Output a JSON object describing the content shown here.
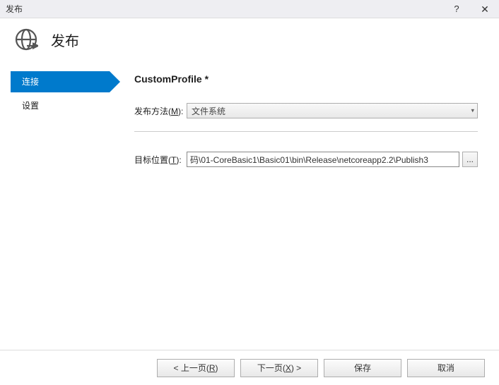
{
  "titlebar": {
    "title": "发布",
    "help": "?",
    "close": "✕"
  },
  "header": {
    "title": "发布"
  },
  "sidebar": {
    "items": [
      {
        "label": "连接",
        "active": true
      },
      {
        "label": "设置",
        "active": false
      }
    ]
  },
  "main": {
    "profile_title": "CustomProfile *",
    "publish_method": {
      "label_pre": "发布方法(",
      "label_key": "M",
      "label_post": "):",
      "value": "文件系统"
    },
    "target_location": {
      "label_pre": "目标位置(",
      "label_key": "T",
      "label_post": "):",
      "value": "码\\01-CoreBasic1\\Basic01\\bin\\Release\\netcoreapp2.2\\Publish3",
      "browse": "..."
    }
  },
  "footer": {
    "prev_pre": "< 上一页(",
    "prev_key": "R",
    "prev_post": ")",
    "next_pre": "下一页(",
    "next_key": "X",
    "next_post": ") >",
    "save": "保存",
    "cancel": "取消"
  }
}
